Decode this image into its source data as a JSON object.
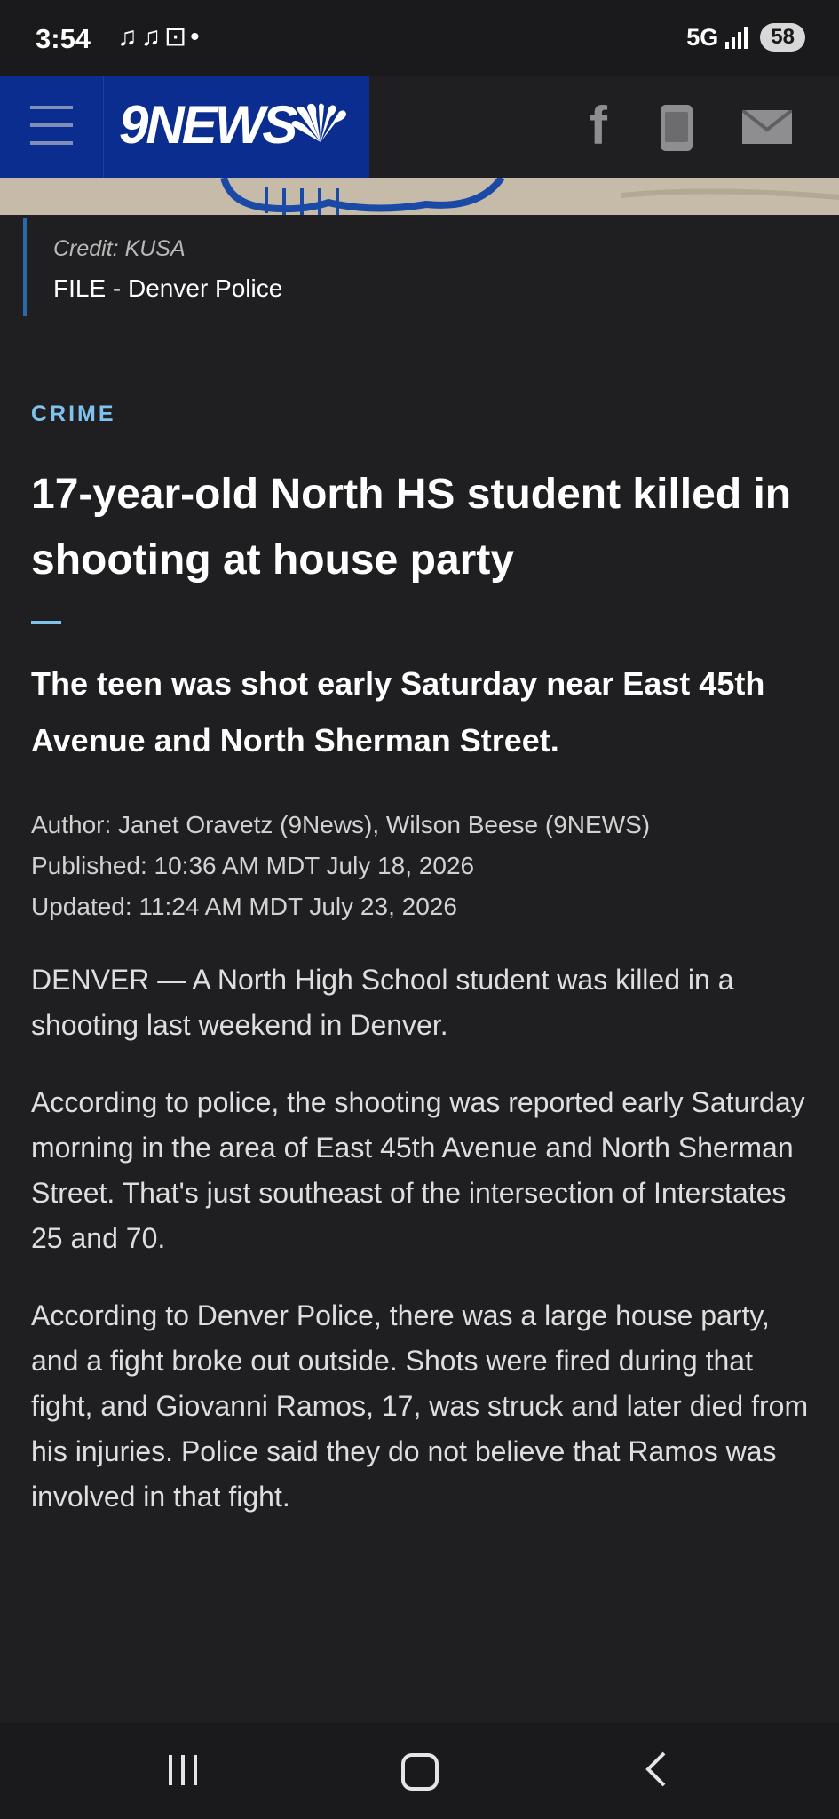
{
  "status_bar": {
    "time": "3:54",
    "left_icons": [
      "music-note-icon",
      "music-note-icon",
      "screenshot-icon",
      "dot-icon"
    ],
    "network": "5G",
    "signal_bars": 4,
    "battery": "58"
  },
  "header": {
    "logo_text": "9NEWS",
    "icons": [
      "menu-icon",
      "facebook-icon",
      "phone-icon",
      "mail-icon"
    ],
    "brand_color": "#0a2d8f"
  },
  "caption": {
    "credit": "Credit: KUSA",
    "title": "FILE - Denver Police"
  },
  "article": {
    "category": "CRIME",
    "headline": "17-year-old North HS student killed in shooting at house party",
    "subheadline": "The teen was shot early Saturday near East 45th Avenue and North Sherman Street.",
    "author": "Author: Janet Oravetz (9News), Wilson Beese (9NEWS)",
    "published": "Published: 10:36 AM MDT July 18, 2026",
    "updated": "Updated: 11:24 AM MDT July 23, 2026",
    "paragraphs": [
      "DENVER — A North High School student was killed in a shooting last weekend in Denver.",
      "According to police, the shooting was reported early Saturday morning in the area of East 45th Avenue and North Sherman Street. That's just southeast of the intersection of Interstates 25 and 70.",
      "According to Denver Police, there was a large house party, and a fight broke out outside. Shots were fired during that fight, and Giovanni Ramos, 17, was struck and later died from his injuries. Police said they do not believe that Ramos was involved in that fight."
    ],
    "accent_color": "#7fc2ee"
  },
  "nav_bar": {
    "icons": [
      "recents-icon",
      "home-icon",
      "back-icon"
    ]
  }
}
